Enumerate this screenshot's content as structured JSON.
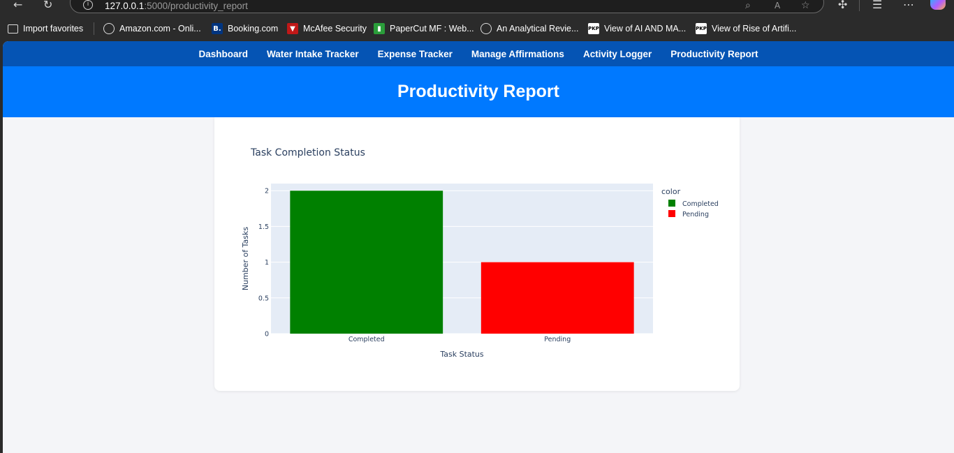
{
  "browser": {
    "url_host": "127.0.0.1",
    "url_path": ":5000/productivity_report",
    "bookmarks": [
      {
        "label": "Import favorites",
        "icon": "import-icon"
      },
      {
        "label": "Amazon.com - Onli...",
        "icon": "globe-icon"
      },
      {
        "label": "Booking.com",
        "icon": "booking-icon",
        "icon_text": "B."
      },
      {
        "label": "McAfee Security",
        "icon": "mcafee-icon"
      },
      {
        "label": "PaperCut MF : Web...",
        "icon": "papercut-icon"
      },
      {
        "label": "An Analytical Revie...",
        "icon": "globe-icon"
      },
      {
        "label": "View of AI AND MA...",
        "icon": "pkp-icon",
        "icon_text": "PKP"
      },
      {
        "label": "View of Rise of Artifi...",
        "icon": "pkp-icon",
        "icon_text": "PKP"
      }
    ]
  },
  "nav": {
    "links": [
      "Dashboard",
      "Water Intake Tracker",
      "Expense Tracker",
      "Manage Affirmations",
      "Activity Logger",
      "Productivity Report"
    ]
  },
  "page": {
    "title": "Productivity Report"
  },
  "chart_data": {
    "type": "bar",
    "title": "Task Completion Status",
    "xlabel": "Task Status",
    "ylabel": "Number of Tasks",
    "categories": [
      "Completed",
      "Pending"
    ],
    "values": [
      2,
      1
    ],
    "colors": [
      "#008000",
      "#ff0000"
    ],
    "ylim": [
      0,
      2.1
    ],
    "yticks": [
      0,
      0.5,
      1,
      1.5,
      2
    ],
    "ytick_labels": [
      "0",
      "0.5",
      "1",
      "1.5",
      "2"
    ],
    "legend": {
      "title": "color",
      "placement": "right",
      "entries": [
        "Completed",
        "Pending"
      ]
    },
    "grid": true,
    "plot_bg": "#e5ecf6"
  },
  "colors": {
    "nav_bg": "#0554b4",
    "hero_bg": "#0079ff",
    "page_bg": "#f4f5f8"
  }
}
